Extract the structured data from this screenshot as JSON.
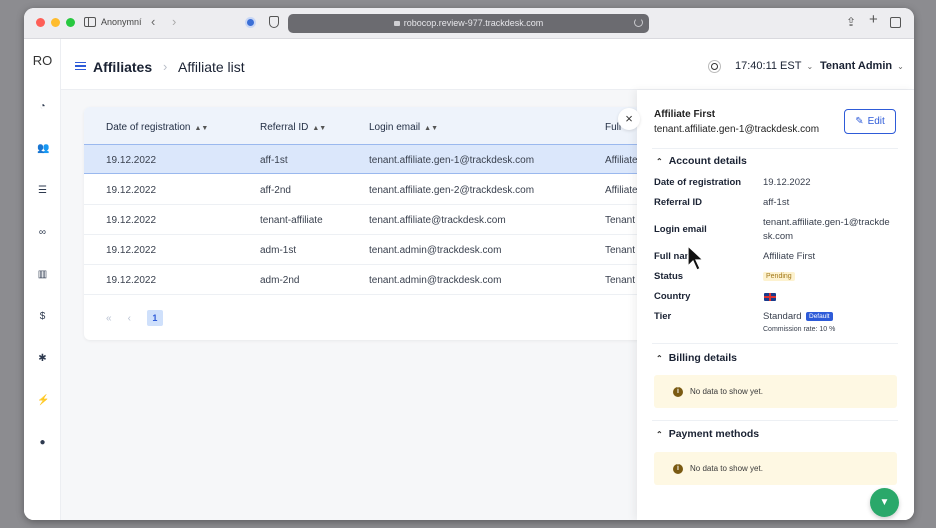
{
  "browser": {
    "profile_label": "Anonymní",
    "url": "robocop.review-977.trackdesk.com"
  },
  "app": {
    "logo": "RO",
    "breadcrumb_root": "Affiliates",
    "breadcrumb_separator": "›",
    "breadcrumb_current": "Affiliate list",
    "clock": "17:40:11 EST",
    "user": "Tenant Admin"
  },
  "table": {
    "columns": [
      "Date of registration",
      "Referral ID",
      "Login email",
      "Full"
    ],
    "rows": [
      {
        "date": "19.12.2022",
        "ref": "aff-1st",
        "email": "tenant.affiliate.gen-1@trackdesk.com",
        "full": "Affiliate"
      },
      {
        "date": "19.12.2022",
        "ref": "aff-2nd",
        "email": "tenant.affiliate.gen-2@trackdesk.com",
        "full": "Affiliate"
      },
      {
        "date": "19.12.2022",
        "ref": "tenant-affiliate",
        "email": "tenant.affiliate@trackdesk.com",
        "full": "Tenant A"
      },
      {
        "date": "19.12.2022",
        "ref": "adm-1st",
        "email": "tenant.admin@trackdesk.com",
        "full": "Tenant A"
      },
      {
        "date": "19.12.2022",
        "ref": "adm-2nd",
        "email": "tenant.admin@trackdesk.com",
        "full": "Tenant A"
      }
    ],
    "pager": {
      "first": "«",
      "prev": "‹",
      "page": "1"
    }
  },
  "drawer": {
    "close_label": "×",
    "name": "Affiliate First",
    "email": "tenant.affiliate.gen-1@trackdesk.com",
    "edit_label": "Edit",
    "account_title": "Account details",
    "fields": {
      "date_label": "Date of registration",
      "date_value": "19.12.2022",
      "ref_label": "Referral ID",
      "ref_value": "aff-1st",
      "login_label": "Login email",
      "login_value": "tenant.affiliate.gen-1@trackdesk.com",
      "fullname_label": "Full name",
      "fullname_value": "Affiliate First",
      "status_label": "Status",
      "status_value": "Pending",
      "country_label": "Country",
      "tier_label": "Tier",
      "tier_value": "Standard",
      "tier_badge": "Default",
      "commission": "Commission rate: 10 %"
    },
    "billing_title": "Billing details",
    "billing_empty": "No data to show yet.",
    "payment_title": "Payment methods",
    "payment_empty": "No data to show yet."
  },
  "colors": {
    "accent": "#2e5bd8",
    "selected_row": "#dbe7fb",
    "fab": "#2aa86a",
    "pending": "#a2781a"
  }
}
